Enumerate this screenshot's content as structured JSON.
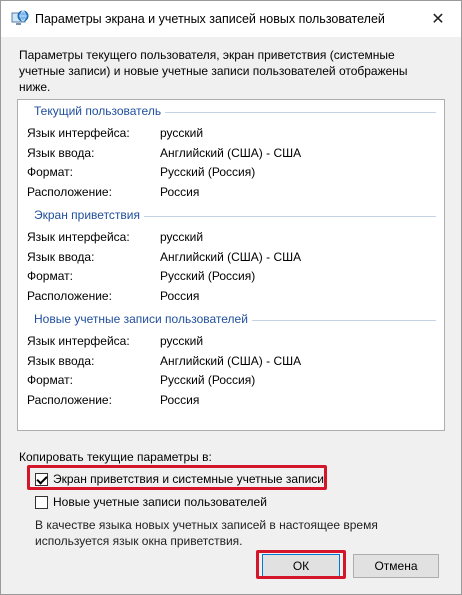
{
  "window": {
    "title": "Параметры экрана и учетных записей новых пользователей",
    "close_glyph": "✕"
  },
  "description": "Параметры текущего пользователя, экран приветствия (системные учетные записи) и новые учетные записи пользователей отображены ниже.",
  "sections": [
    {
      "header": "Текущий пользователь",
      "rows": [
        {
          "label": "Язык интерфейса:",
          "value": "русский"
        },
        {
          "label": "Язык ввода:",
          "value": "Английский (США) - США"
        },
        {
          "label": "Формат:",
          "value": "Русский (Россия)"
        },
        {
          "label": "Расположение:",
          "value": "Россия"
        }
      ]
    },
    {
      "header": "Экран приветствия",
      "rows": [
        {
          "label": "Язык интерфейса:",
          "value": "русский"
        },
        {
          "label": "Язык ввода:",
          "value": "Английский (США) - США"
        },
        {
          "label": "Формат:",
          "value": "Русский (Россия)"
        },
        {
          "label": "Расположение:",
          "value": "Россия"
        }
      ]
    },
    {
      "header": "Новые учетные записи пользователей",
      "rows": [
        {
          "label": "Язык интерфейса:",
          "value": "русский"
        },
        {
          "label": "Язык ввода:",
          "value": "Английский (США) - США"
        },
        {
          "label": "Формат:",
          "value": "Русский (Россия)"
        },
        {
          "label": "Расположение:",
          "value": "Россия"
        }
      ]
    }
  ],
  "copy_label": "Копировать текущие параметры в:",
  "checkboxes": [
    {
      "label": "Экран приветствия и системные учетные записи",
      "checked": true
    },
    {
      "label": "Новые учетные записи пользователей",
      "checked": false
    }
  ],
  "note": "В качестве языка новых учетных записей в настоящее время используется язык окна приветствия.",
  "buttons": {
    "ok": "ОК",
    "cancel": "Отмена"
  },
  "colors": {
    "section_header": "#1f4e9c",
    "highlight": "#d4152a",
    "ok_border": "#0078d7"
  },
  "icons": {
    "title": "globe-monitor-icon",
    "close": "close-icon",
    "checkmark": "checkmark-icon"
  }
}
